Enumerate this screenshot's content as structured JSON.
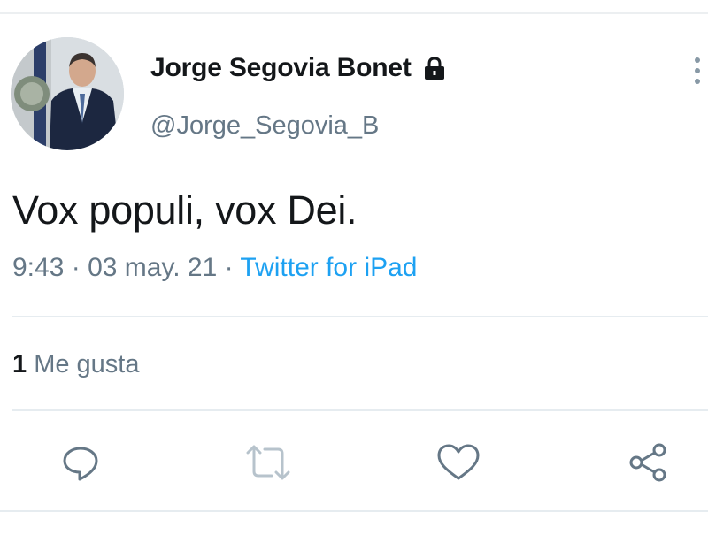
{
  "author": {
    "display_name": "Jorge Segovia Bonet",
    "handle": "@Jorge_Segovia_B",
    "protected_icon": "lock-icon",
    "avatar": "profile-photo"
  },
  "tweet": {
    "text": "Vox populi, vox Dei.",
    "time": "9:43",
    "date": "03 may. 21",
    "separator": "·",
    "source": "Twitter for iPad"
  },
  "engagement": {
    "likes_count": "1",
    "likes_label": "Me gusta"
  },
  "actions": [
    "reply-icon",
    "retweet-icon",
    "like-icon",
    "share-icon"
  ],
  "menu_icon": "more-vertical-icon",
  "colors": {
    "text": "#14171a",
    "secondary": "#657786",
    "link": "#1da1f2",
    "divider": "#e6ecf0"
  }
}
